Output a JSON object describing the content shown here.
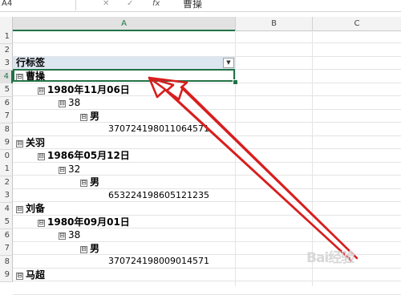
{
  "formula_bar": {
    "name_box": "A4",
    "cancel_icon": "✕",
    "enter_icon": "✓",
    "fx": "fx",
    "value": "曹操"
  },
  "columns": [
    "A",
    "B",
    "C"
  ],
  "rows": [
    "1",
    "2",
    "3",
    "4",
    "5",
    "6",
    "7",
    "8",
    "9",
    "0",
    "1",
    "2",
    "3",
    "4",
    "5",
    "6",
    "7",
    "8",
    "9"
  ],
  "pivot": {
    "header_label": "行标签",
    "items": [
      {
        "text": "曹操",
        "level": 1,
        "toggle": "⊟"
      },
      {
        "text": "1980年11月06日",
        "level": 2,
        "toggle": "⊟"
      },
      {
        "text": "38",
        "level": 3,
        "toggle": "⊟"
      },
      {
        "text": "男",
        "level": 4,
        "toggle": "⊟"
      },
      {
        "text": "370724198011064571",
        "level": 5
      },
      {
        "text": "关羽",
        "level": 1,
        "toggle": "⊟"
      },
      {
        "text": "1986年05月12日",
        "level": 2,
        "toggle": "⊟"
      },
      {
        "text": "32",
        "level": 3,
        "toggle": "⊟"
      },
      {
        "text": "男",
        "level": 4,
        "toggle": "⊟"
      },
      {
        "text": "653224198605121235",
        "level": 5
      },
      {
        "text": "刘备",
        "level": 1,
        "toggle": "⊟"
      },
      {
        "text": "1980年09月01日",
        "level": 2,
        "toggle": "⊟"
      },
      {
        "text": "38",
        "level": 3,
        "toggle": "⊟"
      },
      {
        "text": "男",
        "level": 4,
        "toggle": "⊟"
      },
      {
        "text": "370724198009014571",
        "level": 5
      },
      {
        "text": "马超",
        "level": 1,
        "toggle": "⊟"
      }
    ]
  },
  "annotation": {
    "color": "#d81e1e"
  },
  "watermark": "Bai经验"
}
